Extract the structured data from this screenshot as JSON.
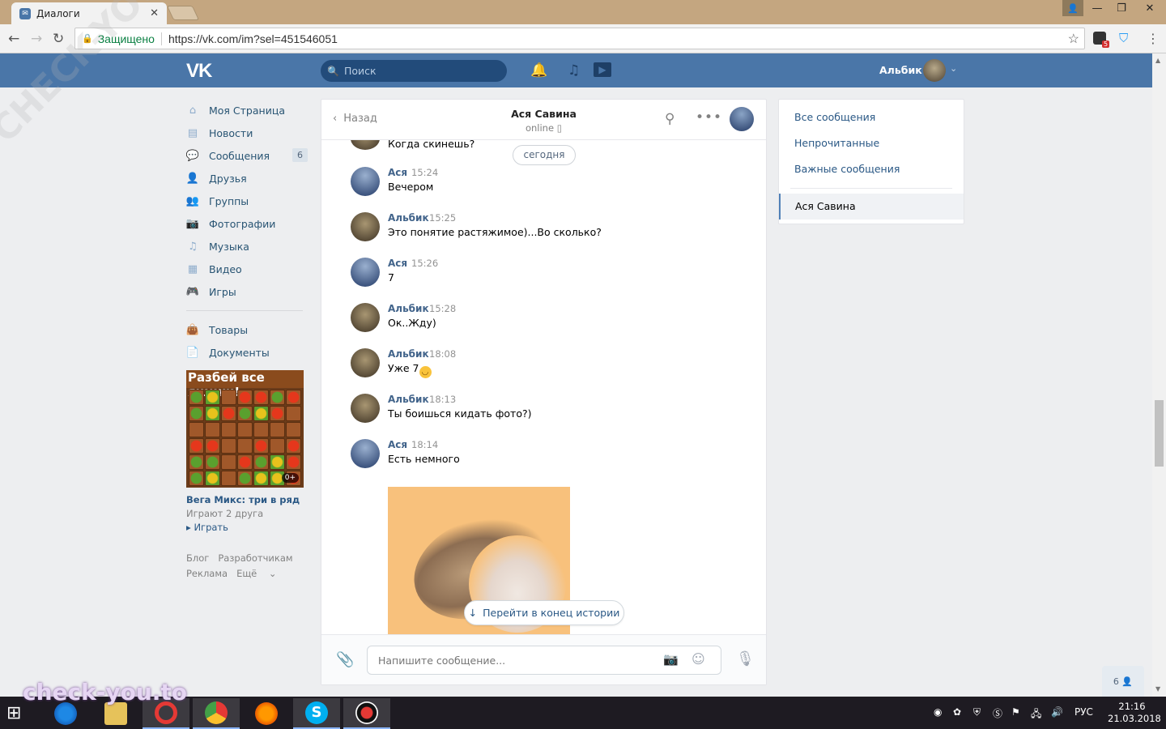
{
  "browser": {
    "tab_title": "Диалоги",
    "secure_label": "Защищено",
    "url": "https://vk.com/im?sel=451546051",
    "ext_badge": "5"
  },
  "vk_header": {
    "logo": "VK",
    "search_placeholder": "Поиск",
    "user_name": "Альбик"
  },
  "left_nav": {
    "items": [
      {
        "label": "Моя Страница",
        "icon": "home-icon"
      },
      {
        "label": "Новости",
        "icon": "news-icon"
      },
      {
        "label": "Сообщения",
        "icon": "messages-icon",
        "badge": "6"
      },
      {
        "label": "Друзья",
        "icon": "friends-icon"
      },
      {
        "label": "Группы",
        "icon": "groups-icon"
      },
      {
        "label": "Фотографии",
        "icon": "camera-icon"
      },
      {
        "label": "Музыка",
        "icon": "music-icon"
      },
      {
        "label": "Видео",
        "icon": "video-icon"
      },
      {
        "label": "Игры",
        "icon": "gamepad-icon"
      }
    ],
    "items2": [
      {
        "label": "Товары",
        "icon": "bag-icon"
      },
      {
        "label": "Документы",
        "icon": "document-icon"
      }
    ],
    "ad": {
      "banner_text": "Разбей все ящики!",
      "age": "0+",
      "title": "Вега Микс: три в ряд",
      "subtitle": "Играют 2 друга",
      "play": "Играть"
    },
    "footer": {
      "blog": "Блог",
      "dev": "Разработчикам",
      "ads": "Реклама",
      "more": "Ещё"
    }
  },
  "chat": {
    "back_label": "Назад",
    "name": "Ася Савина",
    "status": "online",
    "date_divider": "сегодня",
    "partial_message": "Когда скинешь?",
    "messages": [
      {
        "author": "Ася",
        "time": "15:24",
        "text": "Вечером",
        "who": "asya"
      },
      {
        "author": "Альбик",
        "time": "15:25",
        "text": "Это понятие растяжимое)...Во сколько?",
        "who": "albik"
      },
      {
        "author": "Ася",
        "time": "15:26",
        "text": "7",
        "who": "asya"
      },
      {
        "author": "Альбик",
        "time": "15:28",
        "text": "Ок..Жду)",
        "who": "albik"
      },
      {
        "author": "Альбик",
        "time": "18:08",
        "text": "Уже 7",
        "who": "albik",
        "emoji": "smile"
      },
      {
        "author": "Альбик",
        "time": "18:13",
        "text": "Ты боишься кидать фото?)",
        "who": "albik"
      },
      {
        "author": "Ася",
        "time": "18:14",
        "text": "Есть немного",
        "who": "asya"
      }
    ],
    "goto_end": "Перейти в конец истории",
    "compose_placeholder": "Напишите сообщение..."
  },
  "right_panel": {
    "all": "Все сообщения",
    "unread": "Непрочитанные",
    "important": "Важные сообщения",
    "active_dialog": "Ася Савина"
  },
  "online_counter": "6",
  "taskbar": {
    "lang": "РУС",
    "time": "21:16",
    "date": "21.03.2018"
  },
  "watermarks": {
    "diagonal": "CHECK-YOU.ME",
    "bottom": "check-you.to"
  },
  "colors": {
    "vk_blue": "#4a76a8",
    "link": "#2a5885"
  }
}
